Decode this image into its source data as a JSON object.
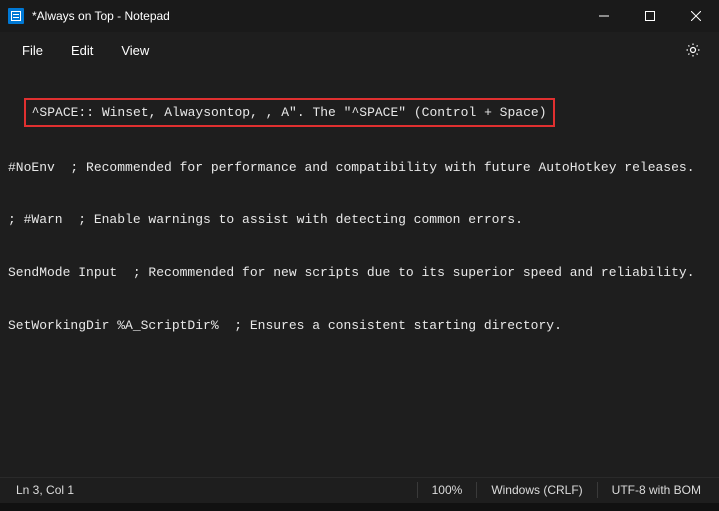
{
  "window": {
    "title": "*Always on Top - Notepad"
  },
  "menu": {
    "file": "File",
    "edit": "Edit",
    "view": "View"
  },
  "editor": {
    "highlighted_line": "^SPACE:: Winset, Alwaysontop, , A\". The \"^SPACE\" (Control + Space)",
    "line1": "#NoEnv  ; Recommended for performance and compatibility with future AutoHotkey releases.",
    "line2": "; #Warn  ; Enable warnings to assist with detecting common errors.",
    "line3": "SendMode Input  ; Recommended for new scripts due to its superior speed and reliability.",
    "line4": "SetWorkingDir %A_ScriptDir%  ; Ensures a consistent starting directory."
  },
  "status": {
    "position": "Ln 3, Col 1",
    "zoom": "100%",
    "line_ending": "Windows (CRLF)",
    "encoding": "UTF-8 with BOM"
  }
}
